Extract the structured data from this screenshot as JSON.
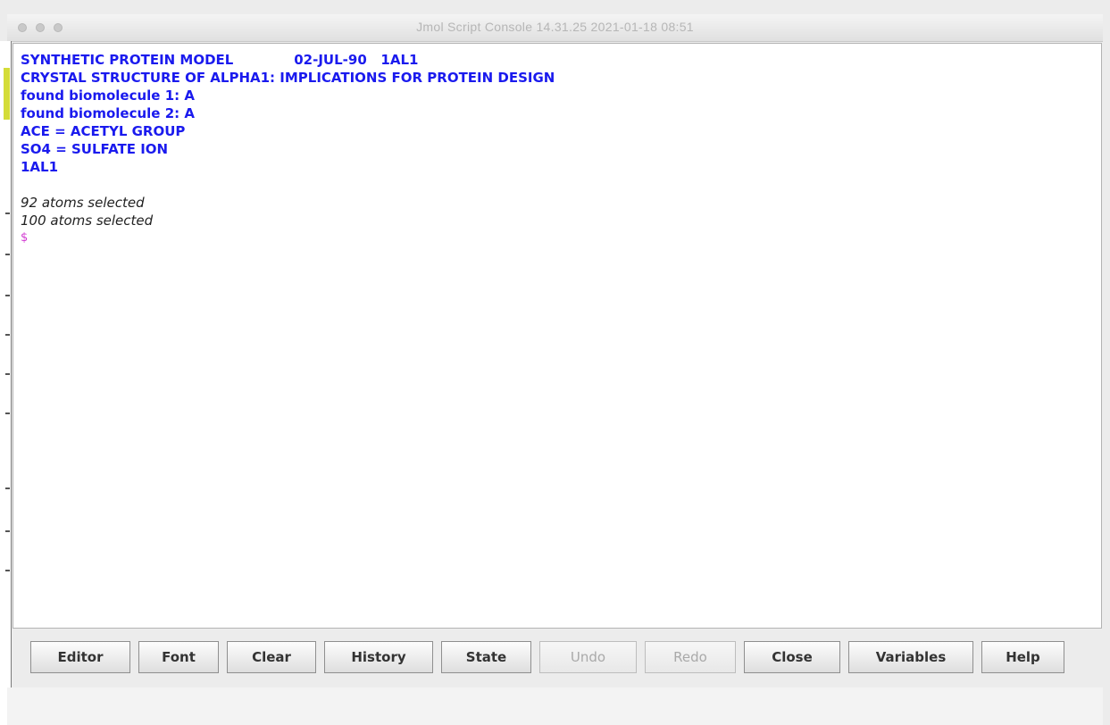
{
  "window": {
    "title": "Jmol Script Console 14.31.25 2021-01-18 08:51"
  },
  "console": {
    "header_lines": [
      "SYNTHETIC PROTEIN MODEL             02-JUL-90   1AL1",
      "CRYSTAL STRUCTURE OF ALPHA1: IMPLICATIONS FOR PROTEIN DESIGN",
      "found biomolecule 1: A",
      "found biomolecule 2: A",
      "ACE = ACETYL GROUP",
      "SO4 = SULFATE ION",
      "1AL1"
    ],
    "output_lines": [
      "92 atoms selected",
      "100 atoms selected"
    ],
    "prompt": "$"
  },
  "buttons": {
    "editor": "Editor",
    "font": "Font",
    "clear": "Clear",
    "history": "History",
    "state": "State",
    "undo": "Undo",
    "redo": "Redo",
    "close": "Close",
    "variables": "Variables",
    "help": "Help"
  },
  "colors": {
    "header_text": "#1a1aee",
    "output_text": "#222222",
    "prompt": "#d23ad2",
    "accent_strip": "#d4dc38"
  }
}
